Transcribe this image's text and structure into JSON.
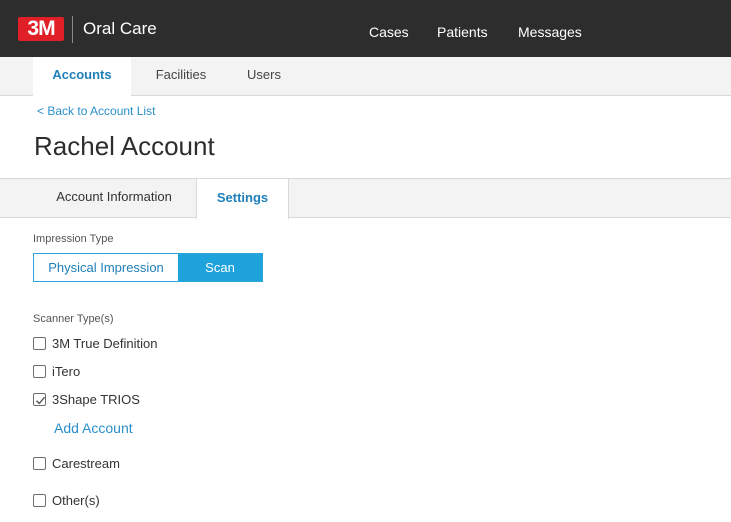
{
  "brand": {
    "logo_text": "3M",
    "app_name": "Oral Care",
    "logo_color": "#e01f26"
  },
  "main_nav": [
    "Cases",
    "Patients",
    "Messages"
  ],
  "sub_nav": {
    "tabs": [
      "Accounts",
      "Facilities",
      "Users"
    ],
    "active": "Accounts"
  },
  "back_link": "< Back to Account List",
  "page_title": "Rachel Account",
  "content_tabs": {
    "tabs": [
      "Account Information",
      "Settings"
    ],
    "active": "Settings"
  },
  "impression": {
    "label": "Impression Type",
    "options": [
      "Physical Impression",
      "Scan"
    ],
    "selected": "Scan"
  },
  "scanner": {
    "label": "Scanner Type(s)",
    "items": [
      {
        "label": "3M True Definition",
        "checked": false
      },
      {
        "label": "iTero",
        "checked": false
      },
      {
        "label": "3Shape TRIOS",
        "checked": true
      },
      {
        "label": "Carestream",
        "checked": false
      },
      {
        "label": "Other(s)",
        "checked": false
      }
    ],
    "add_account_label": "Add Account"
  },
  "colors": {
    "accent": "#1fa3dd",
    "link": "#2a8fcb",
    "header_bg": "#2d2d2d"
  }
}
